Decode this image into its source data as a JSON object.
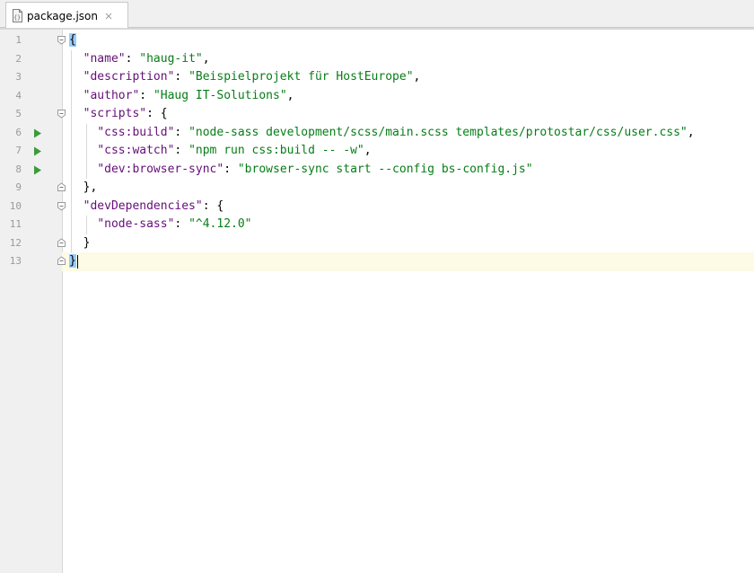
{
  "tab": {
    "label": "package.json",
    "icon": "json-file-icon",
    "close_icon": "close-icon"
  },
  "editor": {
    "current_line": 13,
    "lines": [
      {
        "num": "1",
        "tokens": [
          [
            "p",
            "{"
          ]
        ]
      },
      {
        "num": "2",
        "tokens": [
          [
            "p",
            "  "
          ],
          [
            "k",
            "\"name\""
          ],
          [
            "p",
            ": "
          ],
          [
            "s",
            "\"haug-it\""
          ],
          [
            "p",
            ","
          ]
        ]
      },
      {
        "num": "3",
        "tokens": [
          [
            "p",
            "  "
          ],
          [
            "k",
            "\"description\""
          ],
          [
            "p",
            ": "
          ],
          [
            "s",
            "\"Beispielprojekt für HostEurope\""
          ],
          [
            "p",
            ","
          ]
        ]
      },
      {
        "num": "4",
        "tokens": [
          [
            "p",
            "  "
          ],
          [
            "k",
            "\"author\""
          ],
          [
            "p",
            ": "
          ],
          [
            "s",
            "\"Haug IT-Solutions\""
          ],
          [
            "p",
            ","
          ]
        ]
      },
      {
        "num": "5",
        "tokens": [
          [
            "p",
            "  "
          ],
          [
            "k",
            "\"scripts\""
          ],
          [
            "p",
            ": {"
          ]
        ]
      },
      {
        "num": "6",
        "tokens": [
          [
            "p",
            "    "
          ],
          [
            "k",
            "\"css:build\""
          ],
          [
            "p",
            ": "
          ],
          [
            "s",
            "\"node-sass development/scss/main.scss templates/protostar/css/user.css\""
          ],
          [
            "p",
            ","
          ]
        ]
      },
      {
        "num": "7",
        "tokens": [
          [
            "p",
            "    "
          ],
          [
            "k",
            "\"css:watch\""
          ],
          [
            "p",
            ": "
          ],
          [
            "s",
            "\"npm run css:build -- -w\""
          ],
          [
            "p",
            ","
          ]
        ]
      },
      {
        "num": "8",
        "tokens": [
          [
            "p",
            "    "
          ],
          [
            "k",
            "\"dev:browser-sync\""
          ],
          [
            "p",
            ": "
          ],
          [
            "s",
            "\"browser-sync start --config bs-config.js\""
          ]
        ]
      },
      {
        "num": "9",
        "tokens": [
          [
            "p",
            "  },"
          ]
        ]
      },
      {
        "num": "10",
        "tokens": [
          [
            "p",
            "  "
          ],
          [
            "k",
            "\"devDependencies\""
          ],
          [
            "p",
            ": {"
          ]
        ]
      },
      {
        "num": "11",
        "tokens": [
          [
            "p",
            "    "
          ],
          [
            "k",
            "\"node-sass\""
          ],
          [
            "p",
            ": "
          ],
          [
            "s",
            "\"^4.12.0\""
          ]
        ]
      },
      {
        "num": "12",
        "tokens": [
          [
            "p",
            "  }"
          ]
        ]
      },
      {
        "num": "13",
        "tokens": [
          [
            "p",
            "}"
          ]
        ]
      }
    ],
    "run_lines": [
      6,
      7,
      8
    ],
    "fold_lines": [
      1,
      5,
      9,
      10,
      12,
      13
    ]
  },
  "colors": {
    "property": "#660e7a",
    "string": "#067d17",
    "current_line_bg": "#fdfae5",
    "gutter_bg": "#f0f0f0",
    "run_icon": "#3c9a3c"
  }
}
